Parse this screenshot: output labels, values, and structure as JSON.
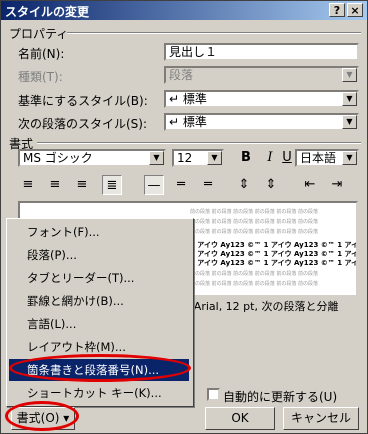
{
  "window": {
    "title": "スタイルの変更",
    "help_btn": "?",
    "close_btn": "×"
  },
  "props": {
    "header": "プロパティ",
    "name_label": "名前(N):",
    "name_value": "見出し１",
    "type_label": "種類(T):",
    "type_value": "段落",
    "base_label": "基準にするスタイル(B):",
    "base_value": "↵ 標準",
    "next_label": "次の段落のスタイル(S):",
    "next_value": "↵ 標準"
  },
  "format": {
    "header": "書式",
    "font": "MS ゴシック",
    "size": "12",
    "bold": "B",
    "italic": "I",
    "underline": "U",
    "lang": "日本語"
  },
  "preview": {
    "gray_text": "前の段落 前の段落 前の段落 前の段落 前の段落 前の段落",
    "sample_text": "1 アイウ Ay123 ©™ 1 アイウ Ay123 ©™ 1 アイウ",
    "description": "英) Arial, 12 pt, 次の段落と分離"
  },
  "menu": {
    "items": [
      "フォント(F)...",
      "段落(P)...",
      "タブとリーダー(T)...",
      "罫線と網かけ(B)...",
      "言語(L)...",
      "レイアウト枠(M)...",
      "箇条書きと段落番号(N)...",
      "ショートカット キー(K)..."
    ]
  },
  "footer": {
    "format_btn": "書式(O) ▾",
    "auto_update": "自動的に更新する(U)",
    "ok": "OK",
    "cancel": "キャンセル"
  },
  "colors": {
    "title_from": "#0a246a",
    "title_to": "#a6caf0",
    "highlight": "#0a246a",
    "annotation": "#e00000"
  }
}
